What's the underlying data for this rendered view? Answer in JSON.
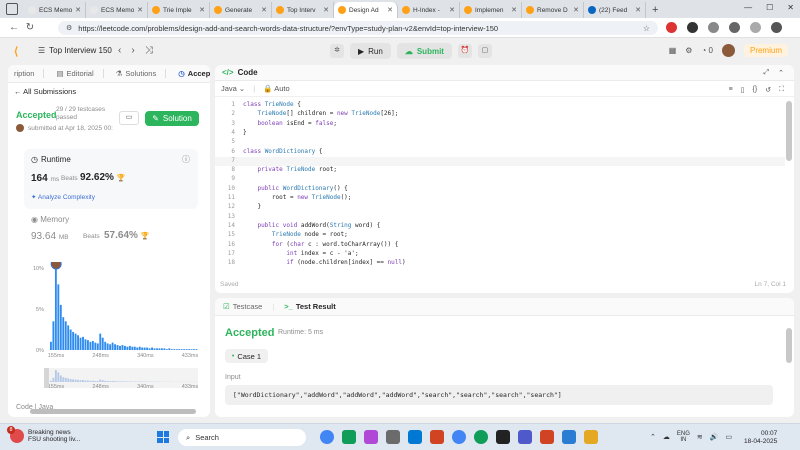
{
  "browser": {
    "tabs": [
      {
        "label": "ECS Memo",
        "color": "#e8e8e8"
      },
      {
        "label": "ECS Memo",
        "color": "#e8e8e8"
      },
      {
        "label": "Trie Imple",
        "color": "#ffa116"
      },
      {
        "label": "Generate",
        "color": "#ffa116"
      },
      {
        "label": "Top Interv",
        "color": "#ffa116"
      },
      {
        "label": "Design Ad",
        "color": "#ffa116",
        "active": true
      },
      {
        "label": "H-Index -",
        "color": "#ffa116"
      },
      {
        "label": "Implemen",
        "color": "#ffa116"
      },
      {
        "label": "Remove D",
        "color": "#ffa116"
      },
      {
        "label": "(22) Feed",
        "color": "#0a66c2"
      }
    ],
    "url": "https://leetcode.com/problems/design-add-and-search-words-data-structure/?envType=study-plan-v2&envId=top-interview-150"
  },
  "nav": {
    "problem_list": "Top Interview 150",
    "run_label": "Run",
    "submit_label": "Submit",
    "coins": "0",
    "premium_label": "Premium"
  },
  "left_panel": {
    "tabs": [
      "ription",
      "Editorial",
      "Solutions",
      "Accepted"
    ],
    "all_submissions": "All Submissions",
    "status": "Accepted",
    "passed": "29 / 29 testcases passed",
    "submitted": "submitted at Apr 18, 2025 00:",
    "solution_label": "Solution",
    "runtime": {
      "title": "Runtime",
      "value": "164",
      "unit": "ms",
      "beats_label": "Beats",
      "beats_pct": "92.62%",
      "analyze": "Analyze Complexity"
    },
    "memory": {
      "title": "Memory",
      "value": "93.64",
      "unit": "MB",
      "beats_label": "Beats",
      "beats_pct": "57.64%"
    },
    "histogram": {
      "y_ticks": [
        "10%",
        "5%",
        "0%"
      ],
      "x_ticks": [
        "155ms",
        "248ms",
        "340ms",
        "433ms"
      ]
    },
    "code_label": "Code",
    "lang_label": "Java"
  },
  "chart_data": {
    "type": "bar",
    "title": "",
    "xlabel": "",
    "ylabel": "",
    "ylim": [
      0,
      10
    ],
    "x_ticks": [
      "155ms",
      "248ms",
      "340ms",
      "433ms"
    ],
    "values": [
      1,
      3.5,
      10,
      8,
      5.5,
      4,
      3.5,
      3,
      2.5,
      2.2,
      2,
      1.8,
      1.5,
      1.6,
      1.3,
      1.2,
      1.0,
      1.1,
      0.9,
      0.8,
      2.0,
      1.5,
      1.0,
      0.8,
      0.7,
      0.9,
      0.7,
      0.6,
      0.5,
      0.6,
      0.5,
      0.4,
      0.5,
      0.4,
      0.4,
      0.3,
      0.4,
      0.3,
      0.3,
      0.3,
      0.2,
      0.3,
      0.2,
      0.2,
      0.2,
      0.2,
      0.2,
      0.1,
      0.2,
      0.1,
      0.1,
      0.1,
      0.1,
      0.1,
      0.1,
      0.1,
      0.1,
      0.1,
      0.1,
      0.1
    ],
    "highlight_index": 2
  },
  "code_panel": {
    "title": "Code",
    "language": "Java",
    "mode": "Auto",
    "lines": [
      "class TrieNode {",
      "    TrieNode[] children = new TrieNode[26];",
      "    boolean isEnd = false;",
      "}",
      "",
      "class WordDictionary {",
      "",
      "    private TrieNode root;",
      "",
      "    public WordDictionary() {",
      "        root = new TrieNode();",
      "    }",
      "",
      "    public void addWord(String word) {",
      "        TrieNode node = root;",
      "        for (char c : word.toCharArray()) {",
      "            int index = c - 'a';",
      "            if (node.children[index] == null)"
    ],
    "saved": "Saved",
    "cursor": "Ln 7, Col 1"
  },
  "result_panel": {
    "tabs": [
      "Testcase",
      "Test Result"
    ],
    "status": "Accepted",
    "runtime": "Runtime: 5 ms",
    "case_label": "Case 1",
    "input_label": "Input",
    "input_value": "[\"WordDictionary\",\"addWord\",\"addWord\",\"addWord\",\"search\",\"search\",\"search\",\"search\"]"
  },
  "taskbar": {
    "news_title": "Breaking news",
    "news_sub": "FSU shooting liv...",
    "news_badge": "8",
    "search_placeholder": "Search",
    "lang1": "ENG",
    "lang2": "IN",
    "time": "00:07",
    "date": "18-04-2025"
  }
}
